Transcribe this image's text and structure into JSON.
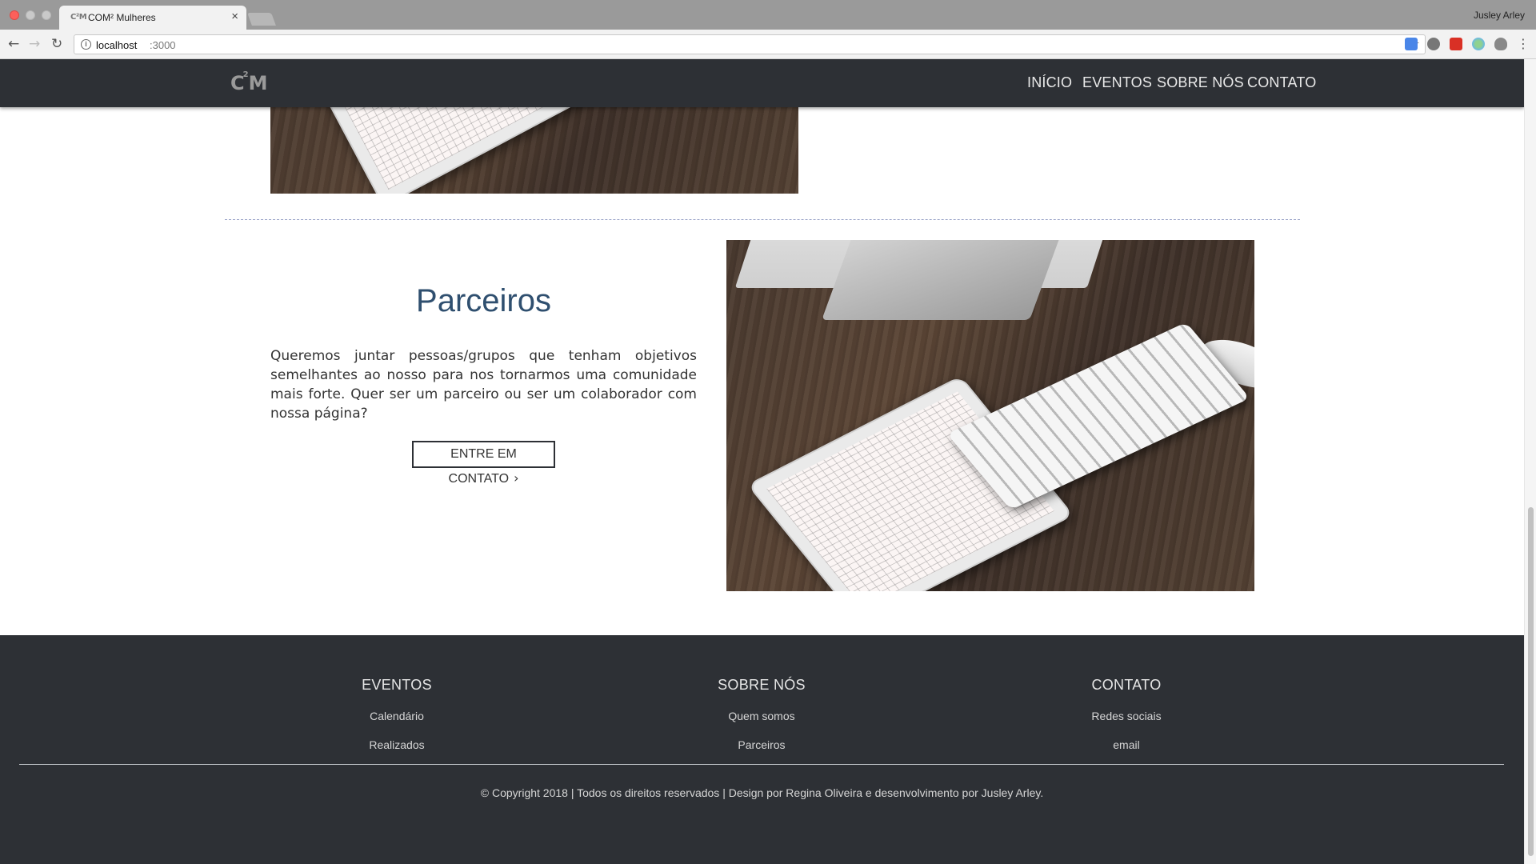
{
  "browser": {
    "tab_title": "COM² Mulheres",
    "tab_favicon": "C²M",
    "profile_name": "Jusley Arley",
    "url_host": "localhost",
    "url_port": ":3000"
  },
  "icons": {
    "back": "arrow-left",
    "forward": "arrow-right",
    "reload": "reload",
    "info": "info",
    "star": "star",
    "menu": "vertical-dots"
  },
  "site": {
    "logo_main": "C",
    "logo_sup": "2",
    "logo_end": "M",
    "nav": {
      "inicio": "INÍCIO",
      "eventos": "EVENTOS",
      "sobre": "SOBRE NÓS",
      "contato": "CONTATO"
    }
  },
  "partners": {
    "title": "Parceiros",
    "text": "Queremos juntar pessoas/grupos que tenham objetivos semelhantes ao nosso para nos tornarmos uma comunidade mais forte. Quer ser um parceiro ou ser um colaborador com nossa página?",
    "button_label": "ENTRE EM CONTATO"
  },
  "footer": {
    "eventos": {
      "title": "EVENTOS",
      "links": [
        "Calendário",
        "Realizados"
      ]
    },
    "sobre": {
      "title": "SOBRE NÓS",
      "links": [
        "Quem somos",
        "Parceiros"
      ]
    },
    "contato": {
      "title": "CONTATO",
      "links": [
        "Redes sociais",
        "email"
      ]
    },
    "copyright": "© Copyright 2018 | Todos os direitos reservados | Design por Regina Oliveira e desenvolvimento por Jusley Arley."
  },
  "colors": {
    "nav_bg": "#2d3035",
    "heading": "#2f4f6f",
    "footer_bg": "#2d3035"
  }
}
